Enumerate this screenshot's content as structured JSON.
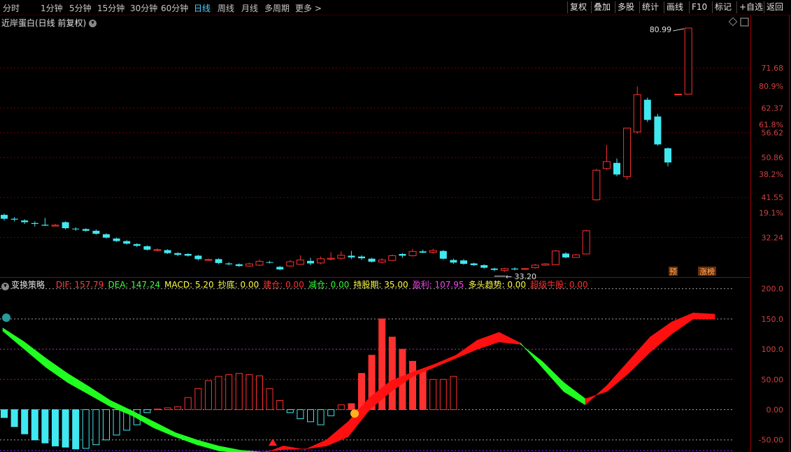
{
  "toolbar": {
    "tabs": [
      "分时",
      "1分钟",
      "5分钟",
      "15分钟",
      "30分钟",
      "60分钟",
      "日线",
      "周线",
      "月线",
      "多周期",
      "更多 >"
    ],
    "active_tab": "日线",
    "right_buttons": [
      "复权",
      "叠加",
      "多股",
      "统计",
      "画线",
      "F10",
      "标记",
      "+自选",
      "返回"
    ]
  },
  "title": {
    "stock": "近岸蛋白(日线 前复权)"
  },
  "price_axis": {
    "labels": [
      "71.68",
      "62.37",
      "56.62",
      "50.86",
      "41.55",
      "32.24"
    ],
    "pct_labels": [
      "80.9%",
      "61.8%",
      "38.2%",
      "19.1%"
    ]
  },
  "annotations": {
    "high": "80.99",
    "low": "33.20",
    "tag_pre": "预",
    "tag_zhangbang": "涨榜"
  },
  "indicator": {
    "name": "变换策略",
    "items": [
      {
        "label": "DIF: 157.79",
        "color": "#ff4040"
      },
      {
        "label": "DEA: 147.24",
        "color": "#40ff40"
      },
      {
        "label": "MACD: 5.20",
        "color": "#ffff40"
      },
      {
        "label": "抄底: 0.00",
        "color": "#ffff40"
      },
      {
        "label": "建仓: 0.00",
        "color": "#ff3030"
      },
      {
        "label": "减仓: 0.00",
        "color": "#30ff30"
      },
      {
        "label": "持股期: 35.00",
        "color": "#ffff40"
      },
      {
        "label": "盈利: 107.95",
        "color": "#ff40ff"
      },
      {
        "label": "多头趋势: 0.00",
        "color": "#ffff40"
      },
      {
        "label": "超级牛股: 0.00",
        "color": "#ff3030"
      }
    ],
    "axis_labels": [
      "200.0",
      "150.0",
      "100.0",
      "50.00",
      "0.00",
      "-50.00"
    ]
  },
  "colors": {
    "up": "#ff3030",
    "down": "#40e8f0",
    "grid": "#800000"
  },
  "chart_data": {
    "type": "candlestick",
    "candles": [
      [
        37.5,
        36.6,
        37.8,
        36.2
      ],
      [
        36.6,
        36.4,
        37.0,
        36.0
      ],
      [
        36.2,
        35.8,
        36.5,
        35.4
      ],
      [
        35.6,
        35.4,
        36.0,
        34.8
      ],
      [
        35.2,
        35.0,
        36.8,
        34.9
      ],
      [
        34.9,
        35.1,
        35.4,
        34.8
      ],
      [
        35.8,
        34.4,
        36.0,
        34.1
      ],
      [
        34.3,
        34.2,
        34.6,
        33.8
      ],
      [
        34.2,
        33.8,
        34.4,
        33.6
      ],
      [
        33.8,
        33.1,
        34.1,
        32.9
      ],
      [
        33.0,
        32.2,
        33.2,
        32.0
      ],
      [
        32.0,
        31.4,
        32.2,
        31.2
      ],
      [
        31.4,
        30.8,
        31.6,
        30.6
      ],
      [
        30.7,
        30.3,
        30.9,
        30.0
      ],
      [
        30.2,
        29.4,
        30.4,
        29.2
      ],
      [
        29.3,
        29.4,
        29.7,
        29.0
      ],
      [
        29.3,
        28.6,
        29.5,
        28.4
      ],
      [
        28.6,
        28.2,
        28.8,
        27.9
      ],
      [
        28.4,
        28.0,
        28.6,
        27.8
      ],
      [
        28.0,
        27.2,
        28.2,
        26.9
      ],
      [
        27.0,
        27.1,
        27.3,
        26.8
      ],
      [
        27.2,
        26.3,
        27.4,
        26.0
      ],
      [
        26.2,
        26.0,
        26.5,
        25.8
      ],
      [
        26.0,
        25.6,
        26.2,
        25.4
      ],
      [
        25.6,
        26.1,
        26.4,
        25.4
      ],
      [
        25.8,
        26.7,
        27.1,
        25.6
      ],
      [
        26.5,
        26.4,
        26.8,
        26.2
      ],
      [
        25.4,
        24.8,
        25.6,
        24.6
      ],
      [
        25.6,
        26.6,
        27.0,
        25.4
      ],
      [
        26.0,
        27.0,
        28.1,
        25.9
      ],
      [
        26.8,
        26.2,
        27.5,
        25.8
      ],
      [
        26.3,
        27.3,
        27.8,
        26.0
      ],
      [
        27.2,
        27.4,
        28.8,
        26.9
      ],
      [
        27.4,
        28.1,
        29.0,
        27.1
      ],
      [
        28.0,
        27.6,
        29.1,
        27.2
      ],
      [
        27.8,
        27.4,
        28.1,
        27.0
      ],
      [
        27.3,
        26.6,
        27.5,
        26.4
      ],
      [
        26.5,
        27.0,
        27.4,
        26.2
      ],
      [
        26.9,
        28.0,
        28.3,
        26.8
      ],
      [
        28.4,
        28.0,
        28.6,
        27.5
      ],
      [
        28.0,
        29.0,
        29.6,
        27.8
      ],
      [
        29.0,
        28.7,
        29.4,
        28.6
      ],
      [
        28.8,
        29.2,
        29.6,
        28.4
      ],
      [
        29.1,
        27.3,
        29.3,
        27.1
      ],
      [
        27.0,
        26.4,
        27.3,
        26.1
      ],
      [
        26.9,
        26.1,
        27.2,
        25.9
      ],
      [
        26.2,
        25.8,
        26.4,
        25.6
      ],
      [
        25.8,
        25.2,
        26.0,
        25.0
      ],
      [
        25.0,
        24.7,
        25.2,
        24.4
      ],
      [
        24.6,
        25.0,
        25.2,
        24.2
      ],
      [
        25.0,
        24.8,
        25.3,
        24.6
      ],
      [
        24.9,
        25.0,
        25.1,
        24.7
      ],
      [
        25.2,
        25.8,
        26.1,
        25.0
      ],
      [
        25.8,
        26.1,
        26.3,
        25.6
      ],
      [
        25.9,
        29.1,
        29.3,
        25.8
      ],
      [
        28.5,
        27.6,
        28.8,
        27.4
      ],
      [
        27.6,
        28.2,
        28.4,
        27.5
      ],
      [
        28.4,
        33.8,
        34.0,
        28.3
      ],
      [
        41.0,
        47.9,
        48.2,
        40.8
      ],
      [
        48.3,
        49.9,
        53.8,
        47.9
      ],
      [
        49.6,
        46.9,
        50.6,
        46.5
      ],
      [
        46.4,
        57.7,
        57.8,
        45.7
      ],
      [
        56.8,
        65.5,
        67.4,
        56.4
      ],
      [
        64.3,
        59.6,
        64.8,
        59.1
      ],
      [
        60.4,
        53.9,
        61.0,
        53.6
      ],
      [
        53.0,
        49.7,
        53.2,
        48.8
      ],
      [
        65.6,
        65.6,
        65.6,
        65.6
      ],
      [
        65.6,
        80.99,
        81.0,
        65.6
      ]
    ],
    "y_range": [
      24.0,
      81.0
    ],
    "indicator_series": {
      "dif_samples": [
        130,
        100,
        70,
        45,
        25,
        5,
        -10,
        -30,
        -45,
        -58,
        -68,
        -72,
        -74,
        -60,
        -66,
        -50,
        -20,
        20,
        48,
        62,
        75,
        90,
        115,
        128,
        110,
        70,
        30,
        8,
        40,
        80,
        120,
        145,
        160,
        158
      ],
      "dea_samples": [
        135,
        112,
        85,
        60,
        38,
        15,
        -2,
        -20,
        -38,
        -50,
        -60,
        -67,
        -70,
        -66,
        -65,
        -60,
        -45,
        0,
        30,
        55,
        70,
        85,
        100,
        112,
        108,
        80,
        45,
        18,
        30,
        60,
        95,
        125,
        150,
        150
      ],
      "macd_bars": [
        -13,
        -28,
        -40,
        -50,
        -55,
        -60,
        -62,
        -65,
        -64,
        -58,
        -50,
        -42,
        -34,
        -25,
        -5,
        1,
        3,
        5,
        20,
        35,
        48,
        55,
        58,
        60,
        58,
        56,
        35,
        15,
        -5,
        -15,
        -20,
        -25,
        -10,
        8,
        10,
        60,
        90,
        150,
        120,
        100,
        80,
        65,
        50,
        50,
        55
      ],
      "y_range": [
        -70,
        210
      ]
    }
  }
}
